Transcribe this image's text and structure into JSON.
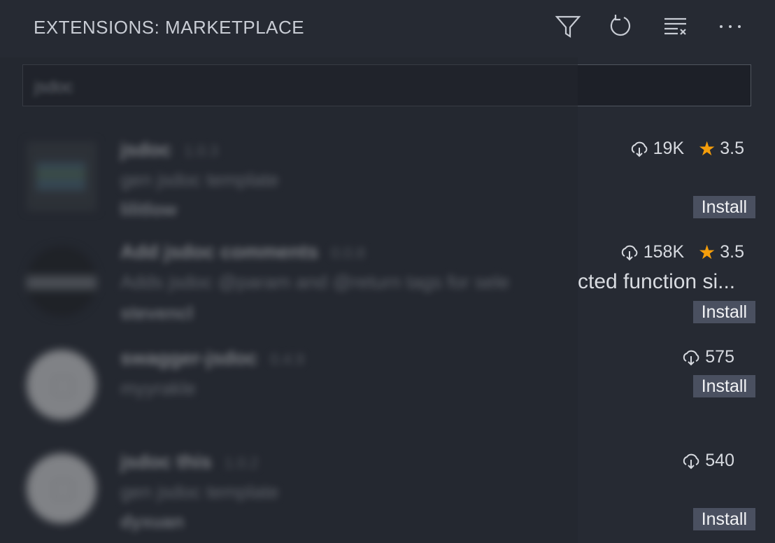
{
  "header": {
    "title": "EXTENSIONS: MARKETPLACE",
    "icons": [
      "filter-icon",
      "refresh-icon",
      "clear-icon",
      "more-icon"
    ]
  },
  "search": {
    "value": "jsdoc"
  },
  "extensions": [
    {
      "name": "jsdoc",
      "version": "1.0.3",
      "description": "gen jsdoc template",
      "publisher": "lilitlow",
      "downloads": "19K",
      "rating": "3.5",
      "install_label": "Install"
    },
    {
      "name": "Add jsdoc comments",
      "version": "0.0.8",
      "description": "Adds jsdoc @param and @return tags for sele",
      "description_visible_tail": "cted function si...",
      "publisher": "stevencl",
      "downloads": "158K",
      "rating": "3.5",
      "install_label": "Install"
    },
    {
      "name": "swagger-jsdoc",
      "version": "0.4.9",
      "description": "myyrakle",
      "publisher": "",
      "downloads": "575",
      "install_label": "Install"
    },
    {
      "name": "jsdoc this",
      "version": "1.0.2",
      "description": "gen jsdoc template",
      "publisher": "dyxuan",
      "downloads": "540",
      "install_label": "Install"
    }
  ],
  "colors": {
    "background": "#262a33",
    "star": "#f59e0b",
    "install_button": "#4a5060"
  }
}
